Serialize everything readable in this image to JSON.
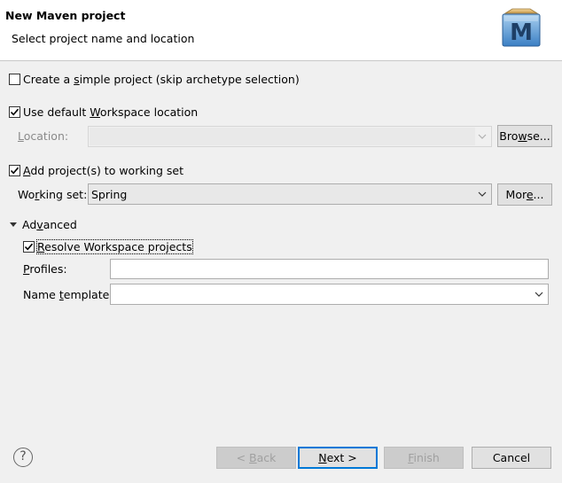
{
  "header": {
    "title": "New Maven project",
    "subtitle": "Select project name and location",
    "logo_letter": "M"
  },
  "options": {
    "simple_project": {
      "pre": "Create a ",
      "mnemonic": "s",
      "post": "imple project (skip archetype selection)",
      "checked": false
    },
    "default_workspace": {
      "pre": "Use default ",
      "mnemonic": "W",
      "post": "orkspace location",
      "checked": true
    },
    "location_label": {
      "mnemonic": "L",
      "post": "ocation:"
    },
    "location_value": "",
    "browse_button": {
      "pre": "Bro",
      "mnemonic": "w",
      "post": "se..."
    },
    "working_set_checkbox": {
      "mnemonic": "A",
      "post": "dd project(s) to working set",
      "checked": true
    },
    "working_set_label": {
      "pre": "Wo",
      "mnemonic": "r",
      "post": "king set:"
    },
    "working_set_value": "Spring",
    "more_button": {
      "pre": "Mor",
      "mnemonic": "e",
      "post": "..."
    }
  },
  "advanced": {
    "section": {
      "pre": "Ad",
      "mnemonic": "v",
      "post": "anced"
    },
    "resolve_workspace": {
      "mnemonic": "R",
      "post": "esolve Workspace projects",
      "checked": true
    },
    "profiles_label": {
      "mnemonic": "P",
      "post": "rofiles:"
    },
    "profiles_value": "",
    "name_template_label": {
      "pre": "Name ",
      "mnemonic": "t",
      "post": "emplate:"
    },
    "name_template_value": ""
  },
  "footer": {
    "help_icon": "?",
    "back": {
      "pre": "< ",
      "mnemonic": "B",
      "post": "ack"
    },
    "next": {
      "mnemonic": "N",
      "post": "ext >"
    },
    "finish": {
      "mnemonic": "F",
      "post": "inish"
    },
    "cancel": "Cancel"
  }
}
